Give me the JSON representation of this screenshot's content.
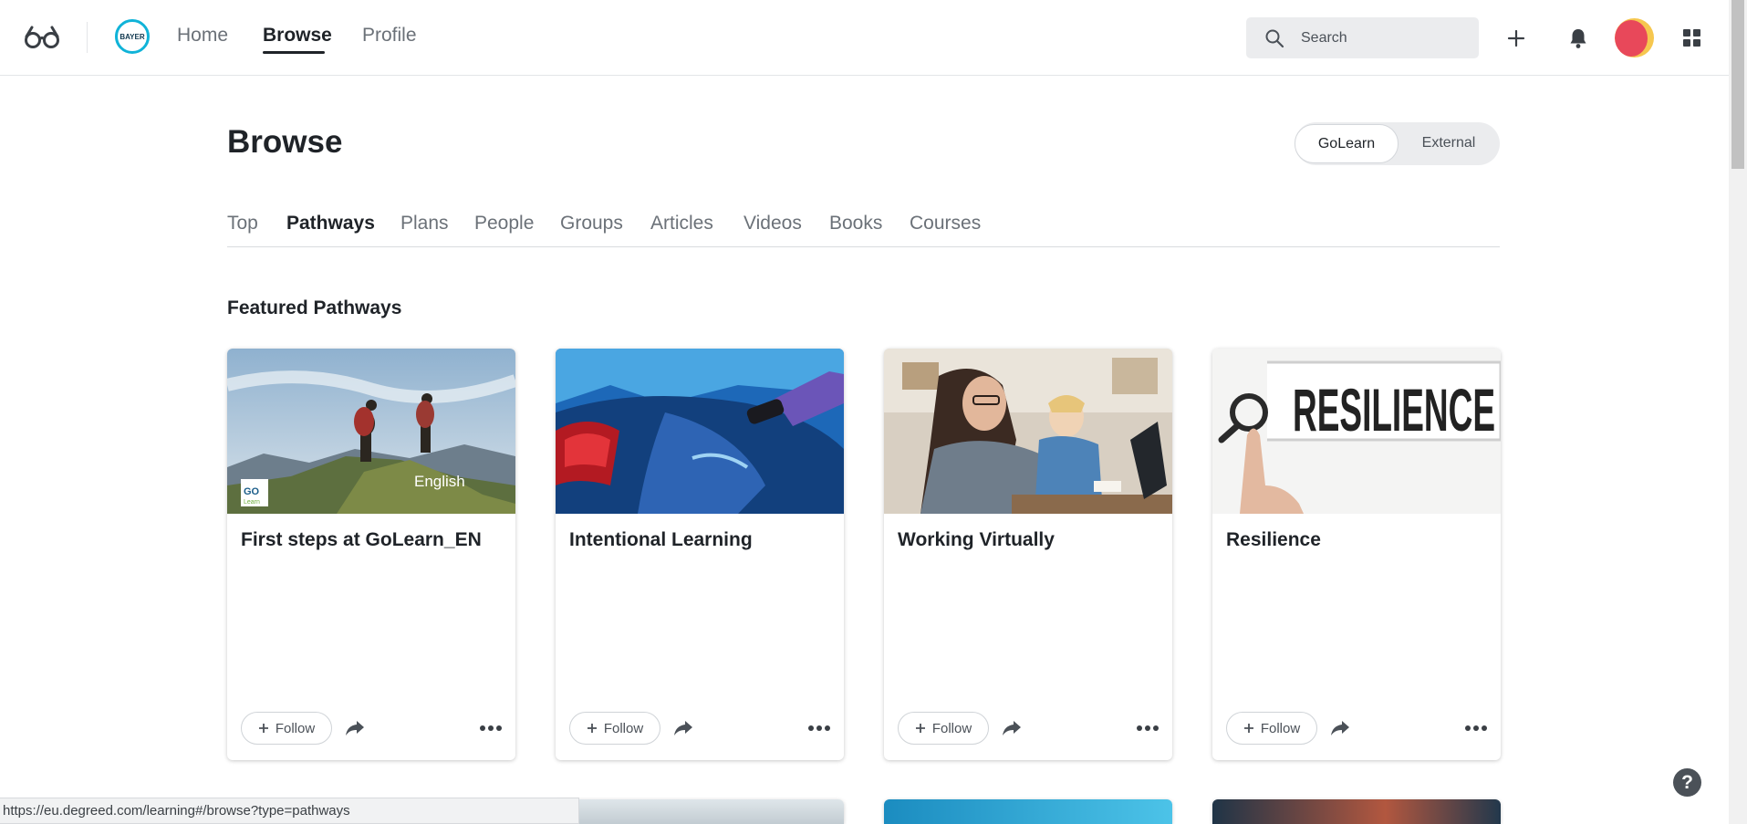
{
  "header": {
    "nav": [
      "Home",
      "Browse",
      "Profile"
    ],
    "active_nav": "Browse",
    "search_placeholder": "Search",
    "org_logo_text": "BAYER",
    "icons": [
      "glasses-logo-icon",
      "add-icon",
      "bell-icon",
      "apps-grid-icon"
    ]
  },
  "page": {
    "title": "Browse",
    "source_toggle": {
      "options": [
        "GoLearn",
        "External"
      ],
      "selected": "GoLearn"
    },
    "tabs": [
      "Top",
      "Pathways",
      "Plans",
      "People",
      "Groups",
      "Articles",
      "Videos",
      "Books",
      "Courses"
    ],
    "active_tab": "Pathways",
    "section_title": "Featured Pathways"
  },
  "cards": [
    {
      "title": "First steps at GoLearn_EN",
      "image_caption": "English",
      "badge": "GO Learn",
      "follow_label": "Follow",
      "image": "hikers-on-mountain"
    },
    {
      "title": "Intentional Learning",
      "follow_label": "Follow",
      "image": "car-charging"
    },
    {
      "title": "Working Virtually",
      "follow_label": "Follow",
      "image": "woman-at-laptop-with-child"
    },
    {
      "title": "Resilience",
      "follow_label": "Follow",
      "image": "resilience-word-magnifier",
      "image_text": "RESILIENCE"
    }
  ],
  "status_bar": {
    "url": "https://eu.degreed.com/learning#/browse?type=pathways"
  },
  "help_label": "?",
  "colors": {
    "accent": "#1f2328",
    "toggle_bg": "#ebecee",
    "org_ring": "#10b3d8",
    "avatar_a": "#f6c74f",
    "avatar_b": "#e8485a"
  }
}
